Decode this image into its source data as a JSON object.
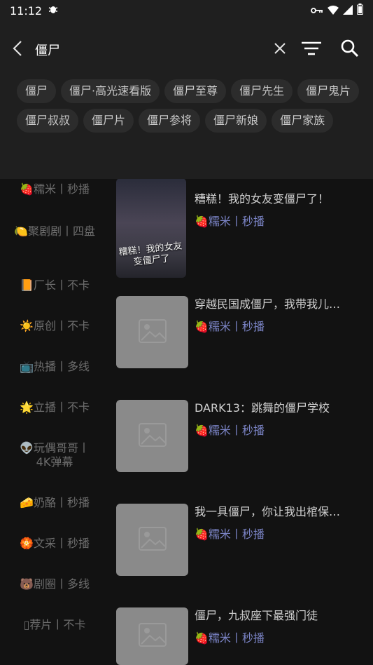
{
  "status_bar": {
    "time": "11:12",
    "notification_icon": "bug-icon",
    "icons": [
      "vpn-key-icon",
      "wifi-icon",
      "signal-icon",
      "battery-icon"
    ]
  },
  "search": {
    "query": "僵尸",
    "back_icon": "chevron-left-icon",
    "clear_icon": "close-icon",
    "filter_icon": "filter-icon",
    "search_icon": "search-icon"
  },
  "chips": [
    "僵尸",
    "僵尸·高光速看版",
    "僵尸至尊",
    "僵尸先生",
    "僵尸鬼片",
    "僵尸叔叔",
    "僵尸片",
    "僵尸参将",
    "僵尸新娘",
    "僵尸家族"
  ],
  "sidebar": {
    "items": [
      {
        "label": "🍓糯米丨秒播"
      },
      {
        "label": "🍋聚剧剧丨四盘"
      },
      {
        "label": "📙厂长丨不卡"
      },
      {
        "label": "☀️原创丨不卡"
      },
      {
        "label": "📺热播丨多线"
      },
      {
        "label": "🌟立播丨不卡"
      },
      {
        "label": "👽玩偶哥哥丨4K弹幕"
      },
      {
        "label": "🧀奶酪丨秒播"
      },
      {
        "label": "🏵️文采丨秒播"
      },
      {
        "label": "🐻剧圈丨多线"
      },
      {
        "label": "▯荐片丨不卡"
      }
    ]
  },
  "results": [
    {
      "title": "糟糕！我的女友变僵尸了！",
      "source": "🍓糯米丨秒播",
      "poster_text": "糟糕！我的女友变僵尸了"
    },
    {
      "title": "穿越民国成僵尸，我带我儿子打鬼子",
      "source": "🍓糯米丨秒播"
    },
    {
      "title": "DARK13：跳舞的僵尸学校",
      "source": "🍓糯米丨秒播"
    },
    {
      "title": "我一具僵尸，你让我出棺保护人类？",
      "source": "🍓糯米丨秒播"
    },
    {
      "title": "僵尸，九叔座下最强门徒",
      "source": "🍓糯米丨秒播"
    }
  ],
  "colors": {
    "background": "#121212",
    "header": "#1f1f1f",
    "chip": "#2c2c2c",
    "source_text": "#7b84c6",
    "sidebar_text": "#6d6d6d"
  }
}
